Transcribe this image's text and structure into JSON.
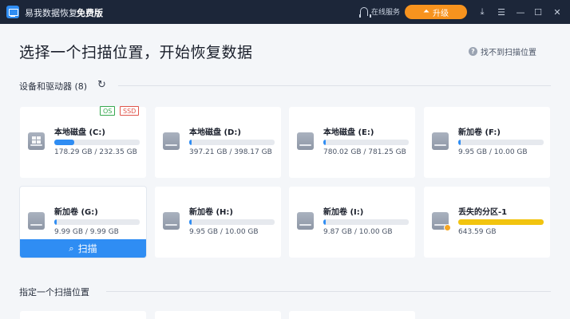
{
  "titlebar": {
    "app_name": "易我数据恢复",
    "edition": "免费版",
    "support_label": "在线服务",
    "upgrade_label": "升级"
  },
  "main": {
    "title": "选择一个扫描位置，开始恢复数据",
    "help_link": "找不到扫描位置",
    "drives_section": "设备和驱动器 (8)",
    "location_section": "指定一个扫描位置",
    "scan_label": "扫描"
  },
  "drives": [
    {
      "name": "本地磁盘 (C:)",
      "size": "178.29 GB / 232.35 GB",
      "fill": 0.23,
      "tags": [
        "OS",
        "SSD"
      ],
      "icon": "windows-drive-icon"
    },
    {
      "name": "本地磁盘 (D:)",
      "size": "397.21 GB / 398.17 GB",
      "fill": 0.03,
      "icon": "hard-drive-icon"
    },
    {
      "name": "本地磁盘 (E:)",
      "size": "780.02 GB / 781.25 GB",
      "fill": 0.03,
      "icon": "hard-drive-icon"
    },
    {
      "name": "新加卷 (F:)",
      "size": "9.95 GB / 10.00 GB",
      "fill": 0.03,
      "icon": "hard-drive-icon"
    },
    {
      "name": "新加卷 (G:)",
      "size": "9.99 GB / 9.99 GB",
      "fill": 0.03,
      "icon": "hard-drive-icon"
    },
    {
      "name": "新加卷 (H:)",
      "size": "9.95 GB / 10.00 GB",
      "fill": 0.03,
      "icon": "hard-drive-icon"
    },
    {
      "name": "新加卷 (I:)",
      "size": "9.87 GB / 10.00 GB",
      "fill": 0.03,
      "icon": "hard-drive-icon"
    },
    {
      "name": "丢失的分区-1",
      "size": "643.59 GB",
      "fill": 1.0,
      "icon": "lost-partition-icon"
    }
  ],
  "colors": {
    "titlebar": "#1c2639",
    "accent": "#2f8df3",
    "upgrade": "#f7931e",
    "lost_bar": "#f2c40f"
  }
}
